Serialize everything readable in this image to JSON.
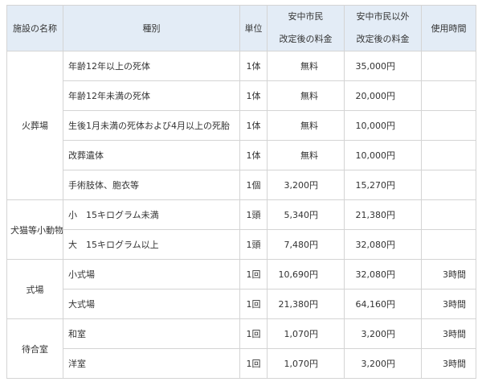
{
  "headers": {
    "facility": "施設の名称",
    "type": "種別",
    "unit": "単位",
    "citizen_line1": "安中市民",
    "citizen_line2": "改定後の料金",
    "noncitizen_line1": "安中市民以外",
    "noncitizen_line2": "改定後の料金",
    "hours": "使用時間"
  },
  "groups": [
    {
      "facility": "火葬場",
      "rows": [
        {
          "type": "年齢12年以上の死体",
          "unit": "1体",
          "citizen": "無料",
          "noncitizen": "35,000円",
          "hours": ""
        },
        {
          "type": "年齢12年未満の死体",
          "unit": "1体",
          "citizen": "無料",
          "noncitizen": "20,000円",
          "hours": ""
        },
        {
          "type": "生後1月未満の死体および4月以上の死胎",
          "unit": "1体",
          "citizen": "無料",
          "noncitizen": "10,000円",
          "hours": ""
        },
        {
          "type": "改葬遺体",
          "unit": "1体",
          "citizen": "無料",
          "noncitizen": "10,000円",
          "hours": ""
        },
        {
          "type": "手術肢体、胞衣等",
          "unit": "1個",
          "citizen": "3,200円",
          "noncitizen": "15,270円",
          "hours": ""
        }
      ]
    },
    {
      "facility": "犬猫等小動物",
      "rows": [
        {
          "type": "小　15キログラム未満",
          "unit": "1頭",
          "citizen": "5,340円",
          "noncitizen": "21,380円",
          "hours": ""
        },
        {
          "type": "大　15キログラム以上",
          "unit": "1頭",
          "citizen": "7,480円",
          "noncitizen": "32,080円",
          "hours": ""
        }
      ]
    },
    {
      "facility": "式場",
      "rows": [
        {
          "type": "小式場",
          "unit": "1回",
          "citizen": "10,690円",
          "noncitizen": "32,080円",
          "hours": "3時間"
        },
        {
          "type": "大式場",
          "unit": "1回",
          "citizen": "21,380円",
          "noncitizen": "64,160円",
          "hours": "3時間"
        }
      ]
    },
    {
      "facility": "待合室",
      "rows": [
        {
          "type": "和室",
          "unit": "1回",
          "citizen": "1,070円",
          "noncitizen": "3,200円",
          "hours": "3時間"
        },
        {
          "type": "洋室",
          "unit": "1回",
          "citizen": "1,070円",
          "noncitizen": "3,200円",
          "hours": "3時間"
        }
      ]
    }
  ],
  "colors": {
    "header_bg": "#e3ecf6",
    "border": "#d4d4d4",
    "text": "#333333"
  }
}
